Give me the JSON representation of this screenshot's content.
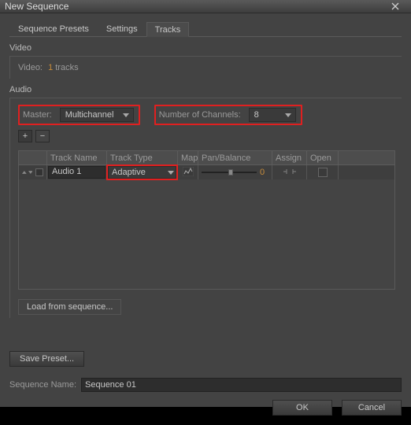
{
  "window": {
    "title": "New Sequence"
  },
  "tabs": [
    {
      "label": "Sequence Presets"
    },
    {
      "label": "Settings"
    },
    {
      "label": "Tracks"
    }
  ],
  "video": {
    "section_title": "Video",
    "label": "Video:",
    "count": "1",
    "suffix": "tracks"
  },
  "audio": {
    "section_title": "Audio",
    "master_label": "Master:",
    "master_value": "Multichannel",
    "channels_label": "Number of Channels:",
    "channels_value": "8",
    "plus": "+",
    "minus": "−",
    "columns": {
      "name": "Track Name",
      "type": "Track Type",
      "map": "Map",
      "pan": "Pan/Balance",
      "assign": "Assign",
      "open": "Open"
    },
    "tracks": [
      {
        "name": "Audio 1",
        "type": "Adaptive",
        "pan_value": "0"
      }
    ],
    "load": "Load from sequence..."
  },
  "save_preset": "Save Preset...",
  "seq_name_label": "Sequence Name:",
  "seq_name_value": "Sequence 01",
  "ok": "OK",
  "cancel": "Cancel"
}
